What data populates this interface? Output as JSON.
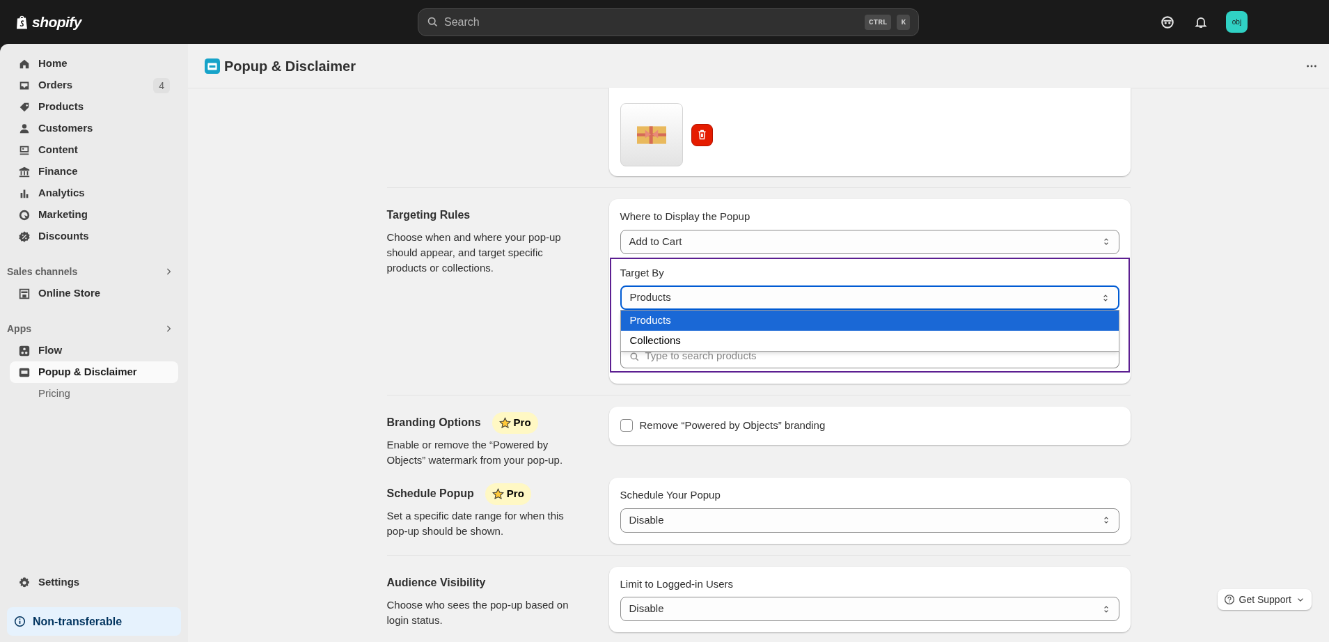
{
  "topbar": {
    "logo": "shopify",
    "search": {
      "placeholder": "Search",
      "shortcut": [
        "CTRL",
        "K"
      ]
    },
    "avatar": "obj"
  },
  "sidebar": {
    "items": [
      {
        "label": "Home",
        "selected": false
      },
      {
        "label": "Orders",
        "badge": "4",
        "selected": false
      },
      {
        "label": "Products",
        "selected": false
      },
      {
        "label": "Customers",
        "selected": false
      },
      {
        "label": "Content",
        "selected": false
      },
      {
        "label": "Finance",
        "selected": false
      },
      {
        "label": "Analytics",
        "selected": false
      },
      {
        "label": "Marketing",
        "selected": false
      },
      {
        "label": "Discounts",
        "selected": false
      }
    ],
    "groups": [
      {
        "title": "Sales channels",
        "items": [
          {
            "label": "Online Store",
            "selected": false
          }
        ]
      },
      {
        "title": "Apps",
        "items": [
          {
            "label": "Flow",
            "selected": false
          },
          {
            "label": "Popup & Disclaimer",
            "selected": true,
            "children": [
              {
                "label": "Pricing",
                "selected": false
              }
            ]
          }
        ]
      }
    ],
    "settings": {
      "label": "Settings"
    },
    "notice": {
      "label": "Non-transferable"
    }
  },
  "page": {
    "title": "Popup & Disclaimer"
  },
  "sections": [
    {
      "fields": [
        {
          "kind": "image"
        }
      ]
    },
    {
      "title": "Targeting Rules",
      "description": "Choose when and where your pop-up should appear, and target specific products or collections.",
      "fields": [
        {
          "kind": "select",
          "label": "Where to Display the Popup",
          "value": "Add to Cart",
          "focused": false
        },
        {
          "kind": "select",
          "label": "Target By",
          "value": "Products",
          "focused": true,
          "outlined": true,
          "options": [
            {
              "label": "Products",
              "selected": true
            },
            {
              "label": "Collections",
              "selected": false
            }
          ],
          "search": {
            "placeholder": "Type to search products"
          }
        }
      ]
    },
    {
      "title": "Branding Options",
      "badge": "Pro",
      "description": "Enable or remove the “Powered by Objects” watermark from your pop-up.",
      "fields": [
        {
          "kind": "checkbox",
          "label": "Remove “Powered by Objects” branding",
          "checked": false
        }
      ]
    },
    {
      "title": "Schedule Popup",
      "badge": "Pro",
      "description": "Set a specific date range for when this pop-up should be shown.",
      "fields": [
        {
          "kind": "select",
          "label": "Schedule Your Popup",
          "value": "Disable",
          "focused": false
        }
      ]
    },
    {
      "title": "Audience Visibility",
      "description": "Choose who sees the pop-up based on login status.",
      "fields": [
        {
          "kind": "select",
          "label": "Limit to Logged-in Users",
          "value": "Disable",
          "focused": false
        }
      ]
    }
  ],
  "support": {
    "label": "Get Support"
  }
}
